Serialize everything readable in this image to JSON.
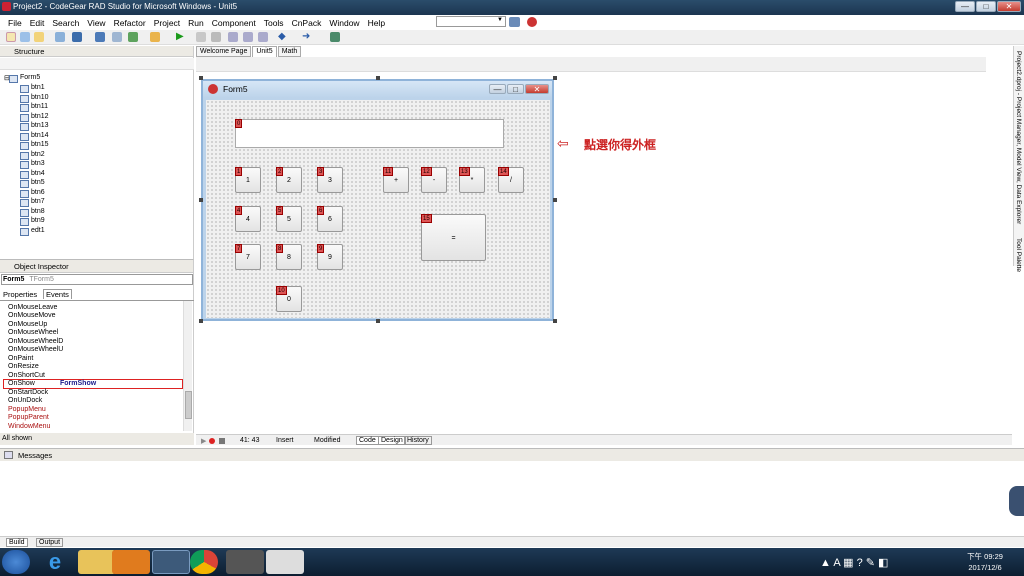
{
  "window": {
    "title": "Project2 - CodeGear RAD Studio for Microsoft Windows - Unit5"
  },
  "menu": [
    "File",
    "Edit",
    "Search",
    "View",
    "Refactor",
    "Project",
    "Run",
    "Component",
    "Tools",
    "CnPack",
    "Window",
    "Help"
  ],
  "structure": {
    "title": "Structure",
    "root": "Form5",
    "items": [
      "btn1",
      "btn10",
      "btn11",
      "btn12",
      "btn13",
      "btn14",
      "btn15",
      "btn2",
      "btn3",
      "btn4",
      "btn5",
      "btn6",
      "btn7",
      "btn8",
      "btn9",
      "edt1"
    ]
  },
  "inspector": {
    "title": "Object Inspector",
    "object_name": "Form5",
    "object_type": "TForm5",
    "tabs": [
      "Properties",
      "Events"
    ],
    "events": [
      {
        "name": "OnMouseLeave",
        "value": ""
      },
      {
        "name": "OnMouseMove",
        "value": ""
      },
      {
        "name": "OnMouseUp",
        "value": ""
      },
      {
        "name": "OnMouseWheel",
        "value": ""
      },
      {
        "name": "OnMouseWheelD",
        "value": ""
      },
      {
        "name": "OnMouseWheelU",
        "value": ""
      },
      {
        "name": "OnPaint",
        "value": ""
      },
      {
        "name": "OnResize",
        "value": ""
      },
      {
        "name": "OnShortCut",
        "value": ""
      },
      {
        "name": "OnShow",
        "value": "FormShow"
      },
      {
        "name": "OnStartDock",
        "value": ""
      },
      {
        "name": "OnUnDock",
        "value": ""
      },
      {
        "name": "PopupMenu",
        "value": ""
      },
      {
        "name": "PopupParent",
        "value": ""
      },
      {
        "name": "WindowMenu",
        "value": ""
      }
    ],
    "footer": "All shown"
  },
  "designer": {
    "tabs": [
      "Welcome Page",
      "Unit5",
      "Math"
    ],
    "form_caption": "Form5",
    "annotation": "點選你得外框",
    "buttons": [
      {
        "tag": "1",
        "label": "1"
      },
      {
        "tag": "2",
        "label": "2"
      },
      {
        "tag": "3",
        "label": "3"
      },
      {
        "tag": "11",
        "label": "+"
      },
      {
        "tag": "12",
        "label": "-"
      },
      {
        "tag": "13",
        "label": "*"
      },
      {
        "tag": "14",
        "label": "/"
      },
      {
        "tag": "4",
        "label": "4"
      },
      {
        "tag": "5",
        "label": "5"
      },
      {
        "tag": "6",
        "label": "6"
      },
      {
        "tag": "7",
        "label": "7"
      },
      {
        "tag": "8",
        "label": "8"
      },
      {
        "tag": "9",
        "label": "9"
      },
      {
        "tag": "10",
        "label": "0"
      },
      {
        "tag": "15",
        "label": "="
      }
    ],
    "edit_tag": "0"
  },
  "editor_status": {
    "position": "41: 43",
    "mode": "Insert",
    "state": "Modified",
    "tabs": [
      "Code",
      "Design",
      "History"
    ]
  },
  "side_tabs": "Project2.dproj - Project Manager, Model View, Data Explorer",
  "side_tabs2": "Tool Palette",
  "messages": {
    "title": "Messages",
    "tabs": [
      "Build",
      "Output"
    ]
  },
  "tray": {
    "time": "下午 09:29",
    "date": "2017/12/6"
  },
  "colors": {
    "highlight_box": "#dd2222",
    "annotation": "#cc2222",
    "form_border": "#8fb3d9"
  }
}
